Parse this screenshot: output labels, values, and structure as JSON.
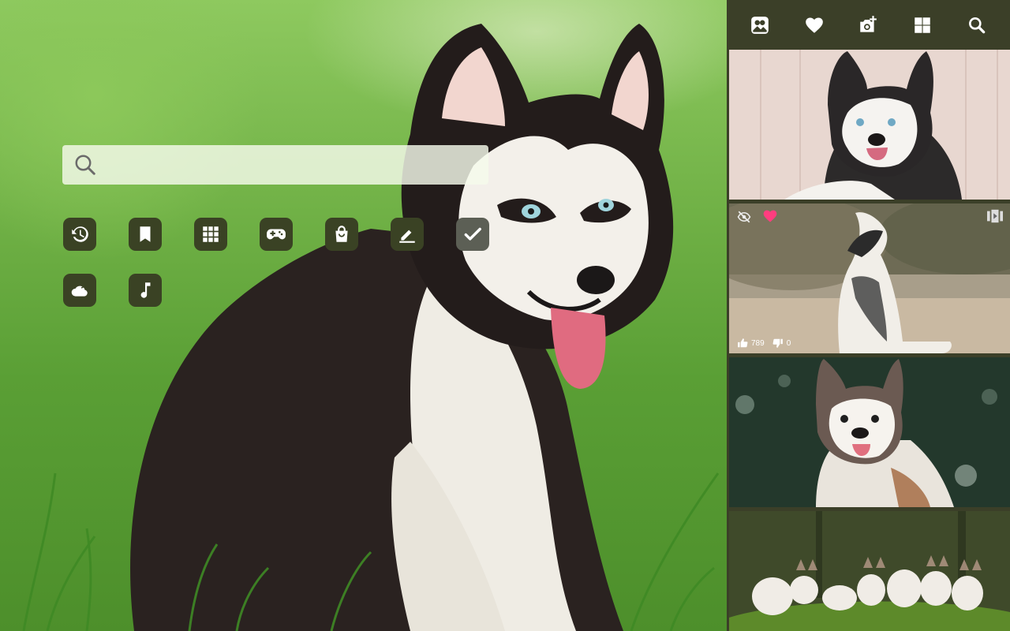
{
  "search": {
    "placeholder": "",
    "value": ""
  },
  "shortcuts": [
    {
      "name": "history-icon"
    },
    {
      "name": "bookmark-icon"
    },
    {
      "name": "apps-grid-icon"
    },
    {
      "name": "gamepad-icon"
    },
    {
      "name": "shopping-bag-icon"
    },
    {
      "name": "edit-icon"
    },
    {
      "name": "checkmark-icon"
    },
    {
      "name": "weather-icon"
    },
    {
      "name": "music-note-icon"
    }
  ],
  "toolbar": [
    {
      "name": "wallpaper-icon"
    },
    {
      "name": "favorites-heart-icon"
    },
    {
      "name": "add-photo-icon"
    },
    {
      "name": "windows-grid-icon"
    },
    {
      "name": "search-icon"
    }
  ],
  "gallery": {
    "items": [
      {
        "name": "husky-puppy-wood-wall"
      },
      {
        "name": "husky-puppy-sitting",
        "likes": "789",
        "dislikes": "0",
        "favorited": true
      },
      {
        "name": "husky-puppy-dark-green"
      },
      {
        "name": "husky-puppies-row-moss"
      }
    ]
  },
  "colors": {
    "panel": "#3b3f28",
    "tile": "#3a4224",
    "heart_active": "#ff3d7f"
  }
}
